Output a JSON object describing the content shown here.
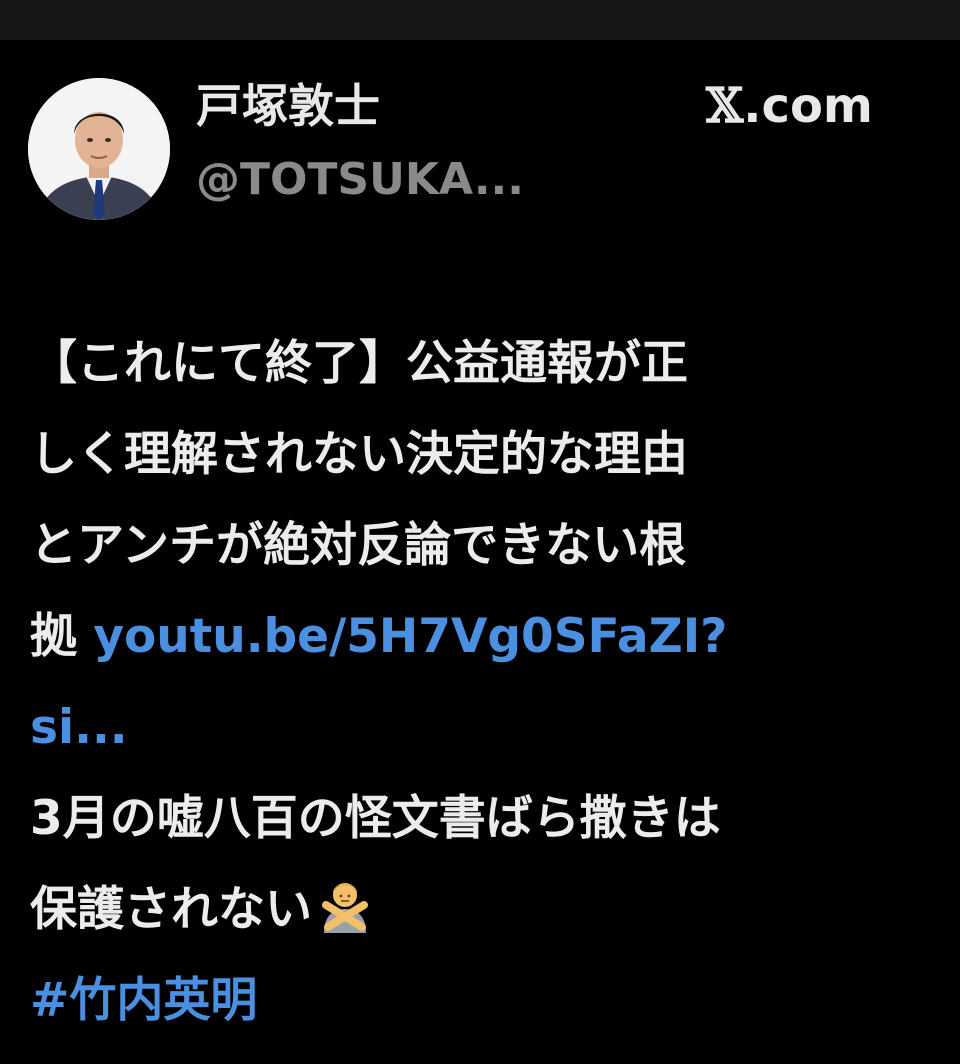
{
  "header": {
    "display_name": "戸塚敦士",
    "handle": "@TOTSUKA...",
    "site_mark": "𝕏",
    "site_suffix": ".com"
  },
  "tweet": {
    "line1": "【これにて終了】公益通報が正",
    "line2": "しく理解されない決定的な理由",
    "line3": "とアンチが絶対反論できない根",
    "line4_text": "拠 ",
    "link_part1": "youtu.be/5H7Vg0SFaZI?",
    "link_part2": "si...",
    "line6": "3月の嘘八百の怪文書ばら撒きは",
    "line7": "保護されない",
    "emoji_name": "person-gesturing-no-emoji",
    "hashtag": "#竹内英明"
  },
  "colors": {
    "background": "#000000",
    "text": "#ececec",
    "handle": "#8a8a8a",
    "link": "#4a8fe0"
  }
}
